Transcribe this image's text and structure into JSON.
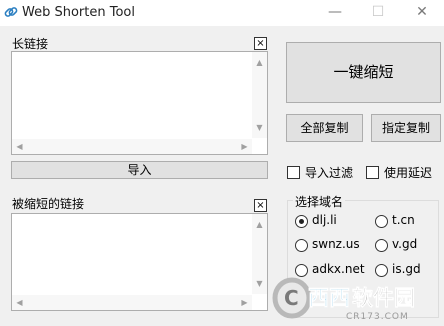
{
  "window": {
    "title": "Web Shorten Tool"
  },
  "long_panel": {
    "label": "长链接",
    "close": "×",
    "text": ""
  },
  "import_button": "导入",
  "short_panel": {
    "label": "被缩短的链接",
    "close": "×",
    "text": ""
  },
  "actions": {
    "one_click": "一键缩短",
    "copy_all": "全部复制",
    "copy_selected": "指定复制"
  },
  "options": {
    "import_filter": {
      "label": "导入过滤",
      "checked": false
    },
    "use_delay": {
      "label": "使用延迟",
      "checked": false
    }
  },
  "domains": {
    "label": "选择域名",
    "items": [
      {
        "label": "dlj.li",
        "checked": true
      },
      {
        "label": "t.cn",
        "checked": false
      },
      {
        "label": "swnz.us",
        "checked": false
      },
      {
        "label": "v.gd",
        "checked": false
      },
      {
        "label": "adkx.net",
        "checked": false
      },
      {
        "label": "is.gd",
        "checked": false
      }
    ]
  },
  "watermark": {
    "text": "西西软件园",
    "sub": "CR173.COM"
  }
}
